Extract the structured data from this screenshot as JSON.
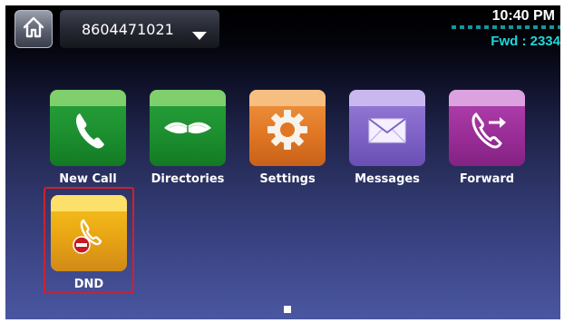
{
  "header": {
    "home_icon": "home-icon",
    "line_number": "8604471021",
    "time": "10:40 PM",
    "forward_status": "Fwd : 2334",
    "forward_status_color": "#1fd6d9"
  },
  "apps": [
    {
      "label": "New Call",
      "icon": "phone-handset-icon",
      "color": "#1f9a33"
    },
    {
      "label": "Directories",
      "icon": "open-book-icon",
      "color": "#1f9a33"
    },
    {
      "label": "Settings",
      "icon": "gear-icon",
      "color": "#e07623"
    },
    {
      "label": "Messages",
      "icon": "envelope-icon",
      "color": "#7e62c6"
    },
    {
      "label": "Forward",
      "icon": "call-forward-icon",
      "color": "#9a2d98"
    },
    {
      "label": "DND",
      "icon": "do-not-disturb-icon",
      "color": "#e9a514",
      "highlighted": true
    }
  ],
  "pager": {
    "current_page": 1,
    "total_pages": 1
  },
  "colors": {
    "highlight": "#d2202b"
  }
}
